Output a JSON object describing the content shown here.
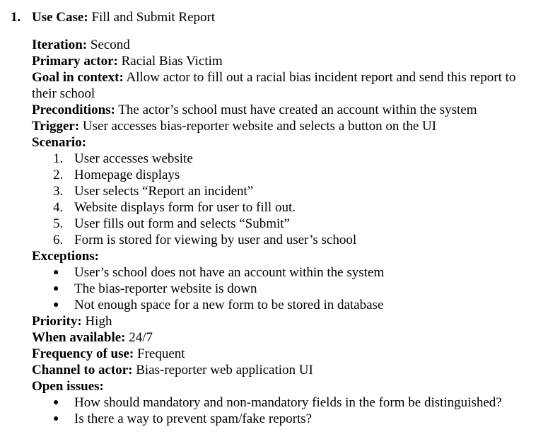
{
  "heading": {
    "number": "1.",
    "label": "Use Case:",
    "value": "Fill and Submit Report"
  },
  "fields": {
    "iteration": {
      "label": "Iteration:",
      "value": "Second"
    },
    "primary_actor": {
      "label": "Primary actor:",
      "value": "Racial Bias Victim"
    },
    "goal": {
      "label": "Goal in context:",
      "value": "Allow actor to fill out a racial bias incident report and send this report to their school"
    },
    "preconditions": {
      "label": "Preconditions:",
      "value": "The actor’s school must have created an account within the system"
    },
    "trigger": {
      "label": "Trigger:",
      "value": "User accesses bias-reporter website and selects a button on the UI"
    },
    "scenario": {
      "label": "Scenario:",
      "steps": [
        {
          "marker": "1.",
          "text": "User accesses website"
        },
        {
          "marker": "2.",
          "text": "Homepage displays"
        },
        {
          "marker": "3.",
          "text": "User selects “Report an incident”"
        },
        {
          "marker": "4.",
          "text": "Website displays form for user to fill out."
        },
        {
          "marker": "5.",
          "text": "User fills out form and selects “Submit”"
        },
        {
          "marker": "6.",
          "text": "Form is stored for viewing by user and user’s school"
        }
      ]
    },
    "exceptions": {
      "label": "Exceptions:",
      "items": [
        "User’s school does not have an account within the system",
        "The bias-reporter website is down",
        "Not enough space for a new form to be stored in database"
      ]
    },
    "priority": {
      "label": "Priority:",
      "value": "High"
    },
    "when_available": {
      "label": "When available:",
      "value": "24/7"
    },
    "frequency": {
      "label": "Frequency of use:",
      "value": "Frequent"
    },
    "channel": {
      "label": "Channel to actor:",
      "value": "Bias-reporter web application UI"
    },
    "open_issues": {
      "label": "Open issues:",
      "items": [
        "How should mandatory and non-mandatory fields in the form be distinguished?",
        "Is there a way to prevent spam/fake reports?"
      ]
    }
  },
  "bullet_glyph": "●"
}
